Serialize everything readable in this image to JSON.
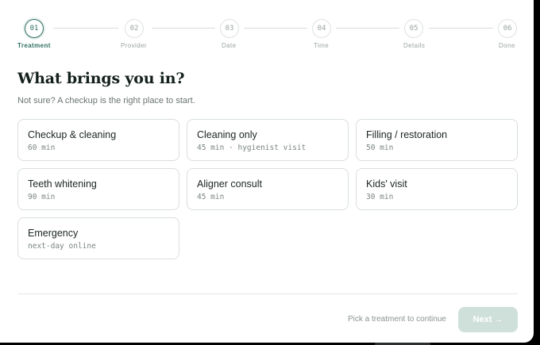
{
  "stepper": {
    "steps": [
      {
        "number": "01",
        "label": "Treatment",
        "active": true
      },
      {
        "number": "02",
        "label": "Provider",
        "active": false
      },
      {
        "number": "03",
        "label": "Date",
        "active": false
      },
      {
        "number": "04",
        "label": "Time",
        "active": false
      },
      {
        "number": "05",
        "label": "Details",
        "active": false
      },
      {
        "number": "06",
        "label": "Done",
        "active": false
      }
    ]
  },
  "main": {
    "title": "What brings you in?",
    "subtitle": "Not sure? A checkup is the right place to start."
  },
  "treatments": [
    {
      "title": "Checkup & cleaning",
      "meta": "60 min"
    },
    {
      "title": "Cleaning only",
      "meta": "45 min · hygienist visit"
    },
    {
      "title": "Filling / restoration",
      "meta": "50 min"
    },
    {
      "title": "Teeth whitening",
      "meta": "90 min"
    },
    {
      "title": "Aligner consult",
      "meta": "45 min"
    },
    {
      "title": "Kids' visit",
      "meta": "30 min"
    },
    {
      "title": "Emergency",
      "meta": "next-day online"
    }
  ],
  "footer": {
    "hint": "Pick a treatment to continue",
    "next_label": "Next",
    "next_icon": "arrow-right-icon",
    "next_enabled": false
  },
  "colors": {
    "accent": "#2f6f62",
    "next_disabled": "#cfe0da",
    "border": "#d9dfdd"
  }
}
